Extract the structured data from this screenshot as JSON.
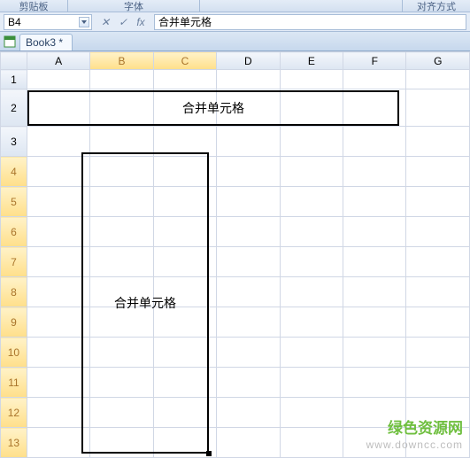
{
  "ribbon": {
    "group_clipboard": "剪贴板",
    "group_font": "字体",
    "group_align": "对齐方式"
  },
  "formula_bar": {
    "name_box": "B4",
    "cancel": "✕",
    "enter": "✓",
    "fx": "fx",
    "value": "合并单元格"
  },
  "file_tab": "Book3 *",
  "columns": [
    "A",
    "B",
    "C",
    "D",
    "E",
    "F",
    "G"
  ],
  "rows": [
    "1",
    "2",
    "3",
    "4",
    "5",
    "6",
    "7",
    "8",
    "9",
    "10",
    "11",
    "12",
    "13"
  ],
  "cells": {
    "merge_h": "合并单元格",
    "merge_v": "合并单元格"
  },
  "selection": {
    "rows": [
      "4",
      "5",
      "6",
      "7",
      "8",
      "9",
      "10",
      "11",
      "12",
      "13"
    ],
    "cols": [
      "B",
      "C"
    ]
  },
  "watermark": {
    "line1": "绿色资源网",
    "line2": "www.downcc.com"
  }
}
